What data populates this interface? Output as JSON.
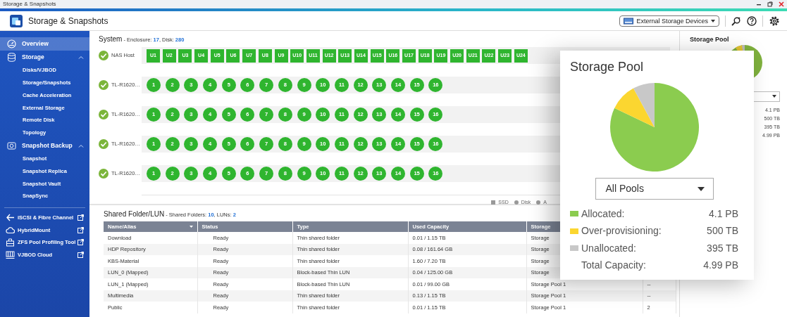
{
  "window": {
    "title": "Storage & Snapshots"
  },
  "header": {
    "title": "Storage & Snapshots",
    "device_menu": "External Storage Devices"
  },
  "sidebar": {
    "items": [
      {
        "label": "Overview",
        "selected": true
      },
      {
        "label": "Storage",
        "selected": false,
        "expanded": true,
        "children": [
          {
            "label": "Disks/VJBOD",
            "selected": false
          },
          {
            "label": "Storage/Snapshots",
            "selected": false
          },
          {
            "label": "Cache Acceleration",
            "selected": false
          },
          {
            "label": "External Storage",
            "selected": false
          },
          {
            "label": "Remote Disk",
            "selected": false
          },
          {
            "label": "Topology",
            "selected": false
          }
        ]
      },
      {
        "label": "Snapshot Backup",
        "selected": false,
        "expanded": true,
        "children": [
          {
            "label": "Snapshot",
            "selected": false
          },
          {
            "label": "Snapshot Replica",
            "selected": false
          },
          {
            "label": "Snapshot Vault",
            "selected": false
          },
          {
            "label": "SnapSync",
            "selected": false
          }
        ]
      }
    ],
    "links": [
      {
        "label": "iSCSI & Fibre Channel"
      },
      {
        "label": "HybridMount"
      },
      {
        "label": "ZFS Pool Profiling Tool"
      },
      {
        "label": "VJBOD Cloud"
      }
    ]
  },
  "system": {
    "title": "System",
    "summary": [
      {
        "text": " - Enclosure: ",
        "kind": "plain"
      },
      {
        "text": "17",
        "kind": "count"
      },
      {
        "text": ", Disk: ",
        "kind": "plain"
      },
      {
        "text": "280",
        "kind": "count"
      }
    ],
    "enclosures": [
      {
        "name": "NAS Host",
        "ok": true,
        "kind": "host",
        "slots": [
          "U1",
          "U2",
          "U3",
          "U4",
          "U5",
          "U6",
          "U7",
          "U8",
          "U9",
          "U10",
          "U11",
          "U12",
          "U13",
          "U14",
          "U15",
          "U16",
          "U17",
          "U18",
          "U19",
          "U20",
          "U21",
          "U22",
          "U23",
          "U24"
        ]
      },
      {
        "name": "TL-R1620…",
        "ok": true,
        "kind": "expansion",
        "slots": [
          "1",
          "2",
          "3",
          "4",
          "5",
          "6",
          "7",
          "8",
          "9",
          "10",
          "11",
          "12",
          "13",
          "14",
          "15",
          "16"
        ]
      },
      {
        "name": "TL-R1620…",
        "ok": true,
        "kind": "expansion",
        "slots": [
          "1",
          "2",
          "3",
          "4",
          "5",
          "6",
          "7",
          "8",
          "9",
          "10",
          "11",
          "12",
          "13",
          "14",
          "15",
          "16"
        ]
      },
      {
        "name": "TL-R1620…",
        "ok": true,
        "kind": "expansion",
        "slots": [
          "1",
          "2",
          "3",
          "4",
          "5",
          "6",
          "7",
          "8",
          "9",
          "10",
          "11",
          "12",
          "13",
          "14",
          "15",
          "16"
        ]
      },
      {
        "name": "TL-R1620…",
        "ok": true,
        "kind": "expansion",
        "slots": [
          "1",
          "2",
          "3",
          "4",
          "5",
          "6",
          "7",
          "8",
          "9",
          "10",
          "11",
          "12",
          "13",
          "14",
          "15",
          "16"
        ]
      }
    ],
    "legend": [
      {
        "label": "SSD",
        "kind": "square"
      },
      {
        "label": "Disk",
        "kind": "dot"
      },
      {
        "label": "A",
        "kind": "dot"
      }
    ]
  },
  "shared": {
    "title": "Shared Folder/LUN",
    "summary": [
      {
        "text": " - Shared Folders: ",
        "kind": "plain"
      },
      {
        "text": "10",
        "kind": "count"
      },
      {
        "text": ", LUNs: ",
        "kind": "plain"
      },
      {
        "text": "2",
        "kind": "count"
      }
    ],
    "table": {
      "columns": [
        {
          "label": "Name/Alias",
          "sorted": true
        },
        {
          "label": "Status"
        },
        {
          "label": "Type"
        },
        {
          "label": "Used Capacity"
        },
        {
          "label": "Storage"
        }
      ],
      "rows": [
        [
          "Download",
          "Ready",
          "Thin shared folder",
          "0.01 / 1.15 TB",
          "Storage"
        ],
        [
          "HDP Repository",
          "Ready",
          "Thin shared folder",
          "0.08 / 161.64 GB",
          "Storage"
        ],
        [
          "KBS-Material",
          "Ready",
          "Thin shared folder",
          "1.60 / 7.20 TB",
          "Storage"
        ],
        [
          "LUN_0 (Mapped)",
          "Ready",
          "Block-based Thin LUN",
          "0.04 / 125.00 GB",
          "Storage"
        ],
        [
          "LUN_1 (Mapped)",
          "Ready",
          "Block-based Thin LUN",
          "0.01 / 99.00 GB",
          "Storage Pool 1",
          "--"
        ],
        [
          "Multimedia",
          "Ready",
          "Thin shared folder",
          "0.13 / 1.15 TB",
          "Storage Pool 1",
          "--"
        ],
        [
          "Public",
          "Ready",
          "Thin shared folder",
          "0.01 / 1.15 TB",
          "Storage Pool 1",
          "2"
        ]
      ]
    }
  },
  "right_panel": {
    "title": "Storage Pool",
    "values": [
      "4.1 PB",
      "500 TB",
      "395 TB",
      "4.99 PB"
    ]
  },
  "popup": {
    "title": "Storage Pool",
    "pool_select": "All Pools",
    "chart_data": {
      "type": "pie",
      "values": [
        82.1,
        10.0,
        7.9
      ]
    },
    "legend": [
      {
        "label": "Allocated:",
        "value": "4.1 PB",
        "color": "#8bcc4f"
      },
      {
        "label": "Over-provisioning:",
        "value": "500 TB",
        "color": "#fbd630"
      },
      {
        "label": "Unallocated:",
        "value": "395 TB",
        "color": "#c8c8c8"
      },
      {
        "label": "Total Capacity:",
        "value": "4.99 PB"
      }
    ]
  }
}
